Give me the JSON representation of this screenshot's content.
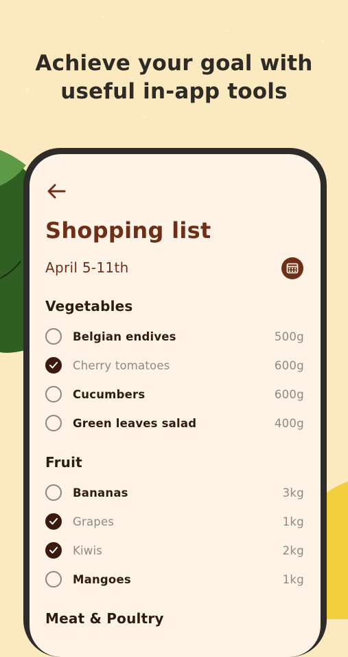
{
  "headline": {
    "line1": "Achieve your goal with",
    "line2": "useful in-app tools"
  },
  "colors": {
    "background": "#fbe9c0",
    "accent_brown": "#6e2f16",
    "leaf_green": "#2f5e22",
    "lemon_yellow": "#f2cf3f",
    "phone_frame": "#2e2c2a",
    "screen_bg": "#fff3e8"
  },
  "screen": {
    "back_icon": "arrow-left-icon",
    "title": "Shopping list",
    "date_range": "April 5-11th",
    "calendar_icon": "calendar-icon",
    "sections": [
      {
        "title": "Vegetables",
        "items": [
          {
            "name": "Belgian endives",
            "qty": "500g",
            "checked": false
          },
          {
            "name": "Cherry tomatoes",
            "qty": "600g",
            "checked": true
          },
          {
            "name": "Cucumbers",
            "qty": "600g",
            "checked": false
          },
          {
            "name": "Green leaves salad",
            "qty": "400g",
            "checked": false
          }
        ]
      },
      {
        "title": "Fruit",
        "items": [
          {
            "name": "Bananas",
            "qty": "3kg",
            "checked": false
          },
          {
            "name": "Grapes",
            "qty": "1kg",
            "checked": true
          },
          {
            "name": "Kiwis",
            "qty": "2kg",
            "checked": true
          },
          {
            "name": "Mangoes",
            "qty": "1kg",
            "checked": false
          }
        ]
      },
      {
        "title": "Meat & Poultry",
        "items": []
      }
    ]
  }
}
